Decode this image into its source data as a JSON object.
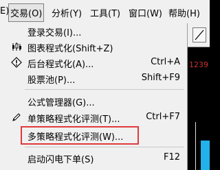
{
  "menubar": {
    "items": [
      {
        "label": "E)"
      },
      {
        "label": "交易(O)"
      },
      {
        "label": "分析(Y)"
      },
      {
        "label": "工具(T)"
      },
      {
        "label": "窗口(W)"
      },
      {
        "label": "帮助(H)"
      }
    ]
  },
  "background": {
    "red_number": "1239"
  },
  "menu": {
    "items": [
      {
        "label": "登录交易(I)...",
        "shortcut": "",
        "icon": ""
      },
      {
        "label": "图表程式化(Shift+Z)",
        "shortcut": "",
        "icon": "chart-bars-icon"
      },
      {
        "label": "后台程式化(A)...",
        "shortcut": "Ctrl+A",
        "icon": "warning-diamond-icon"
      },
      {
        "label": "股票池(P)...",
        "shortcut": "Shift+F9",
        "icon": ""
      },
      {
        "label": "公式管理器(G)...",
        "shortcut": "",
        "icon": ""
      },
      {
        "label": "单策略程式化评测(T)...",
        "shortcut": "Ctrl+F7",
        "icon": "pencil-icon"
      },
      {
        "label": "多策略程式化评测(W)...",
        "shortcut": "",
        "icon": ""
      },
      {
        "label": "启动闪电下单(S)",
        "shortcut": "F12",
        "icon": ""
      }
    ],
    "partial_item": "……………"
  }
}
